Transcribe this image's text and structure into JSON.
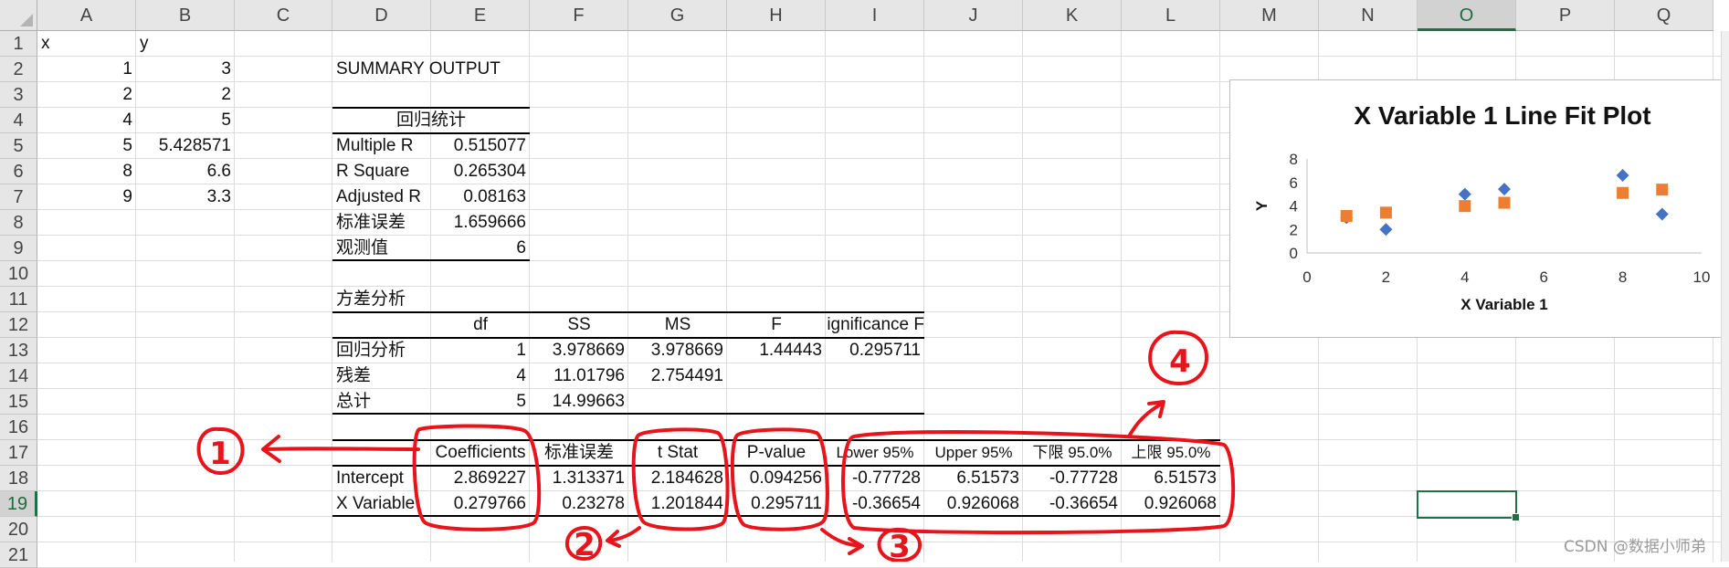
{
  "columns": [
    "A",
    "B",
    "C",
    "D",
    "E",
    "F",
    "G",
    "H",
    "I",
    "J",
    "K",
    "L",
    "M",
    "N",
    "O",
    "P",
    "Q"
  ],
  "rows": [
    "1",
    "2",
    "3",
    "4",
    "5",
    "6",
    "7",
    "8",
    "9",
    "10",
    "11",
    "12",
    "13",
    "14",
    "15",
    "16",
    "17",
    "18",
    "19",
    "20",
    "21"
  ],
  "selected": {
    "column": "O",
    "row": "19"
  },
  "input": {
    "x_label": "x",
    "y_label": "y",
    "x": [
      "1",
      "2",
      "4",
      "5",
      "8",
      "9"
    ],
    "y": [
      "3",
      "2",
      "5",
      "5.428571",
      "6.6",
      "3.3"
    ]
  },
  "summary": {
    "title": "SUMMARY OUTPUT",
    "stats_header": "回归统计",
    "stats": [
      {
        "label": "Multiple R",
        "value": "0.515077"
      },
      {
        "label": "R Square",
        "value": "0.265304"
      },
      {
        "label": "Adjusted R",
        "value": "0.08163"
      },
      {
        "label": "标准误差",
        "value": "1.659666"
      },
      {
        "label": "观测值",
        "value": "6"
      }
    ]
  },
  "anova": {
    "title": "方差分析",
    "headers": [
      "df",
      "SS",
      "MS",
      "F",
      "ignificance F"
    ],
    "rows": [
      {
        "label": "回归分析",
        "cells": [
          "1",
          "3.978669",
          "3.978669",
          "1.44443",
          "0.295711"
        ]
      },
      {
        "label": "残差",
        "cells": [
          "4",
          "11.01796",
          "2.754491",
          "",
          ""
        ]
      },
      {
        "label": "总计",
        "cells": [
          "5",
          "14.99663",
          "",
          "",
          ""
        ]
      }
    ]
  },
  "coef": {
    "headers": [
      "Coefficients",
      "标准误差",
      "t Stat",
      "P-value",
      "Lower 95%",
      "Upper 95%",
      "下限 95.0%",
      "上限 95.0%"
    ],
    "rows": [
      {
        "label": "Intercept",
        "cells": [
          "2.869227",
          "1.313371",
          "2.184628",
          "0.094256",
          "-0.77728",
          "6.51573",
          "-0.77728",
          "6.51573"
        ]
      },
      {
        "label": "X Variable",
        "cells": [
          "0.279766",
          "0.23278",
          "1.201844",
          "0.295711",
          "-0.36654",
          "0.926068",
          "-0.36654",
          "0.926068"
        ]
      }
    ]
  },
  "chart_data": {
    "type": "scatter",
    "title": "X Variable 1 Line Fit  Plot",
    "xlabel": "X Variable 1",
    "ylabel": "Y",
    "xlim": [
      0,
      10
    ],
    "ylim": [
      0,
      8
    ],
    "x_ticks": [
      "0",
      "2",
      "4",
      "6",
      "8",
      "10"
    ],
    "y_ticks": [
      "0",
      "2",
      "4",
      "6",
      "8"
    ],
    "grid": false,
    "series": [
      {
        "color": "#4472c4",
        "marker": "diamond",
        "x": [
          1,
          2,
          4,
          5,
          8,
          9
        ],
        "y": [
          3,
          2,
          5,
          5.428571,
          6.6,
          3.3
        ]
      },
      {
        "color": "#ed7d31",
        "marker": "square",
        "x": [
          1,
          2,
          4,
          5,
          8,
          9
        ],
        "y": [
          3.149,
          3.429,
          3.988,
          4.268,
          5.107,
          5.387
        ]
      }
    ]
  },
  "annotations": {
    "marks": [
      "1",
      "2",
      "3",
      "4"
    ],
    "color": "#e8141c"
  },
  "watermark": "CSDN @数据小师弟"
}
